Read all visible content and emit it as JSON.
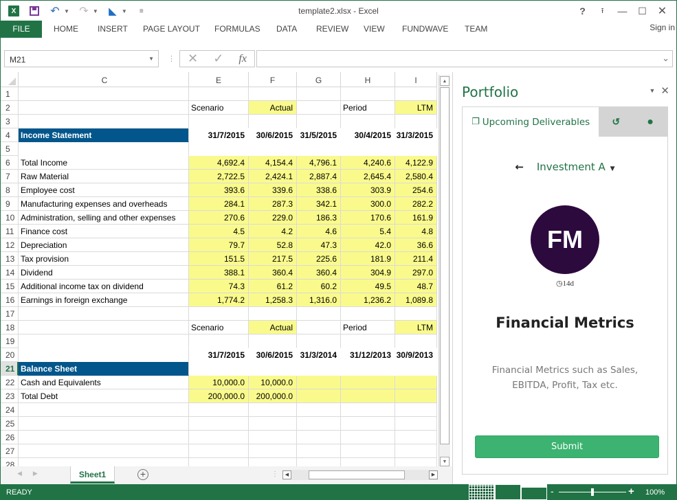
{
  "window": {
    "title": "template2.xlsx - Excel",
    "controls": [
      "help-icon",
      "ribbon-display-icon",
      "minimize-icon",
      "maximize-icon",
      "close-icon"
    ]
  },
  "qat": {
    "icons": [
      "excel-logo-icon",
      "save-icon",
      "undo-icon",
      "redo-icon",
      "fundwave-addin-icon",
      "customize-qat-icon"
    ],
    "logo_text": "X"
  },
  "ribbon": {
    "tabs": [
      "FILE",
      "HOME",
      "INSERT",
      "PAGE LAYOUT",
      "FORMULAS",
      "DATA",
      "REVIEW",
      "VIEW",
      "FUNDWAVE",
      "TEAM"
    ],
    "signin": "Sign in"
  },
  "formula_bar": {
    "name_box": "M21",
    "formula": "",
    "fx": "fx"
  },
  "sheet": {
    "columns": [
      "C",
      "E",
      "F",
      "G",
      "H",
      "I"
    ],
    "selected_row": "21",
    "rows": [
      {
        "n": "1",
        "c": "",
        "v": [
          "",
          "",
          "",
          "",
          ""
        ]
      },
      {
        "n": "2",
        "c": "",
        "v": [
          "Scenario",
          "Actual",
          "",
          "Period",
          "LTM"
        ]
      },
      {
        "n": "3",
        "c": "",
        "v": [
          "",
          "",
          "",
          "",
          ""
        ]
      },
      {
        "n": "4",
        "c": "Income Statement",
        "v": [
          "31/7/2015",
          "30/6/2015",
          "31/5/2015",
          "30/4/2015",
          "31/3/2015"
        ]
      },
      {
        "n": "5",
        "c": "",
        "v": [
          "",
          "",
          "",
          "",
          ""
        ]
      },
      {
        "n": "6",
        "c": "Total Income",
        "v": [
          "4,692.4",
          "4,154.4",
          "4,796.1",
          "4,240.6",
          "4,122.9"
        ]
      },
      {
        "n": "7",
        "c": "Raw Material",
        "v": [
          "2,722.5",
          "2,424.1",
          "2,887.4",
          "2,645.4",
          "2,580.4"
        ]
      },
      {
        "n": "8",
        "c": "Employee cost",
        "v": [
          "393.6",
          "339.6",
          "338.6",
          "303.9",
          "254.6"
        ]
      },
      {
        "n": "9",
        "c": "Manufacturing expenses and overheads",
        "v": [
          "284.1",
          "287.3",
          "342.1",
          "300.0",
          "282.2"
        ]
      },
      {
        "n": "10",
        "c": "Administration, selling and other expenses",
        "v": [
          "270.6",
          "229.0",
          "186.3",
          "170.6",
          "161.9"
        ]
      },
      {
        "n": "11",
        "c": "Finance cost",
        "v": [
          "4.5",
          "4.2",
          "4.6",
          "5.4",
          "4.8"
        ]
      },
      {
        "n": "12",
        "c": "Depreciation",
        "v": [
          "79.7",
          "52.8",
          "47.3",
          "42.0",
          "36.6"
        ]
      },
      {
        "n": "13",
        "c": "Tax provision",
        "v": [
          "151.5",
          "217.5",
          "225.6",
          "181.9",
          "211.4"
        ]
      },
      {
        "n": "14",
        "c": "Dividend",
        "v": [
          "388.1",
          "360.4",
          "360.4",
          "304.9",
          "297.0"
        ]
      },
      {
        "n": "15",
        "c": "Additional income tax on dividend",
        "v": [
          "74.3",
          "61.2",
          "60.2",
          "49.5",
          "48.7"
        ]
      },
      {
        "n": "16",
        "c": "Earnings in foreign exchange",
        "v": [
          "1,774.2",
          "1,258.3",
          "1,316.0",
          "1,236.2",
          "1,089.8"
        ]
      },
      {
        "n": "17",
        "c": "",
        "v": [
          "",
          "",
          "",
          "",
          ""
        ]
      },
      {
        "n": "18",
        "c": "",
        "v": [
          "Scenario",
          "Actual",
          "",
          "Period",
          "LTM"
        ]
      },
      {
        "n": "19",
        "c": "",
        "v": [
          "",
          "",
          "",
          "",
          ""
        ]
      },
      {
        "n": "20",
        "c": "",
        "v": [
          "31/7/2015",
          "30/6/2015",
          "31/3/2014",
          "31/12/2013",
          "30/9/2013"
        ]
      },
      {
        "n": "21",
        "c": "Balance Sheet",
        "v": [
          "",
          "",
          "",
          "",
          ""
        ]
      },
      {
        "n": "22",
        "c": "Cash and Equivalents",
        "v": [
          "10,000.0",
          "10,000.0",
          "",
          "",
          ""
        ]
      },
      {
        "n": "23",
        "c": "Total Debt",
        "v": [
          "200,000.0",
          "200,000.0",
          "",
          "",
          ""
        ]
      },
      {
        "n": "24",
        "c": "",
        "v": [
          "",
          "",
          "",
          "",
          ""
        ]
      },
      {
        "n": "25",
        "c": "",
        "v": [
          "",
          "",
          "",
          "",
          ""
        ]
      },
      {
        "n": "26",
        "c": "",
        "v": [
          "",
          "",
          "",
          "",
          ""
        ]
      },
      {
        "n": "27",
        "c": "",
        "v": [
          "",
          "",
          "",
          "",
          ""
        ]
      },
      {
        "n": "28",
        "c": "",
        "v": [
          "",
          "",
          "",
          "",
          ""
        ]
      }
    ],
    "sheet_tabs": [
      "Sheet1"
    ],
    "active_sheet": "Sheet1",
    "colors": {
      "header_fill": "#02568b",
      "input_fill": "#fafa8c"
    }
  },
  "pane": {
    "title": "Portfolio",
    "tabs": [
      {
        "label": "Upcoming Deliverables",
        "icon": "copy-icon"
      },
      {
        "label": "",
        "icon": "history-icon"
      },
      {
        "label": "",
        "icon": "globe-icon"
      }
    ],
    "investment": "Investment A",
    "avatar_initials": "FM",
    "due": "14d",
    "metric_title": "Financial Metrics",
    "metric_desc": "Financial Metrics such as Sales, EBITDA, Profit, Tax etc.",
    "submit_label": "Submit",
    "colors": {
      "accent": "#217346",
      "avatar_bg": "#2d0a3d",
      "submit_bg": "#3cb371"
    }
  },
  "status": {
    "ready": "READY",
    "zoom": "100%",
    "zoom_value": 100
  }
}
